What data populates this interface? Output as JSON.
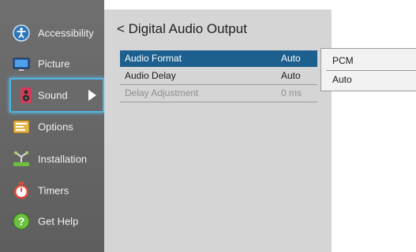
{
  "sidebar": {
    "items": [
      {
        "label": "Accessibility",
        "icon": "accessibility-icon"
      },
      {
        "label": "Picture",
        "icon": "tv-icon"
      },
      {
        "label": "Sound",
        "icon": "speaker-icon",
        "selected": true
      },
      {
        "label": "Options",
        "icon": "options-icon"
      },
      {
        "label": "Installation",
        "icon": "network-icon"
      },
      {
        "label": "Timers",
        "icon": "timer-icon"
      },
      {
        "label": "Get Help",
        "icon": "help-icon"
      }
    ]
  },
  "panel": {
    "title": "< Digital Audio Output",
    "rows": [
      {
        "name": "Audio Format",
        "value": "Auto",
        "state": "active"
      },
      {
        "name": "Audio Delay",
        "value": "Auto",
        "state": "normal"
      },
      {
        "name": "Delay Adjustment",
        "value": "0 ms",
        "state": "disabled"
      }
    ]
  },
  "dropdown": {
    "options": [
      "PCM",
      "Auto"
    ]
  },
  "colors": {
    "highlight": "#1d5f8e",
    "focus_border": "#4fb4e4",
    "sidebar_bg": "#666666",
    "panel_bg": "#d5d5d5"
  }
}
